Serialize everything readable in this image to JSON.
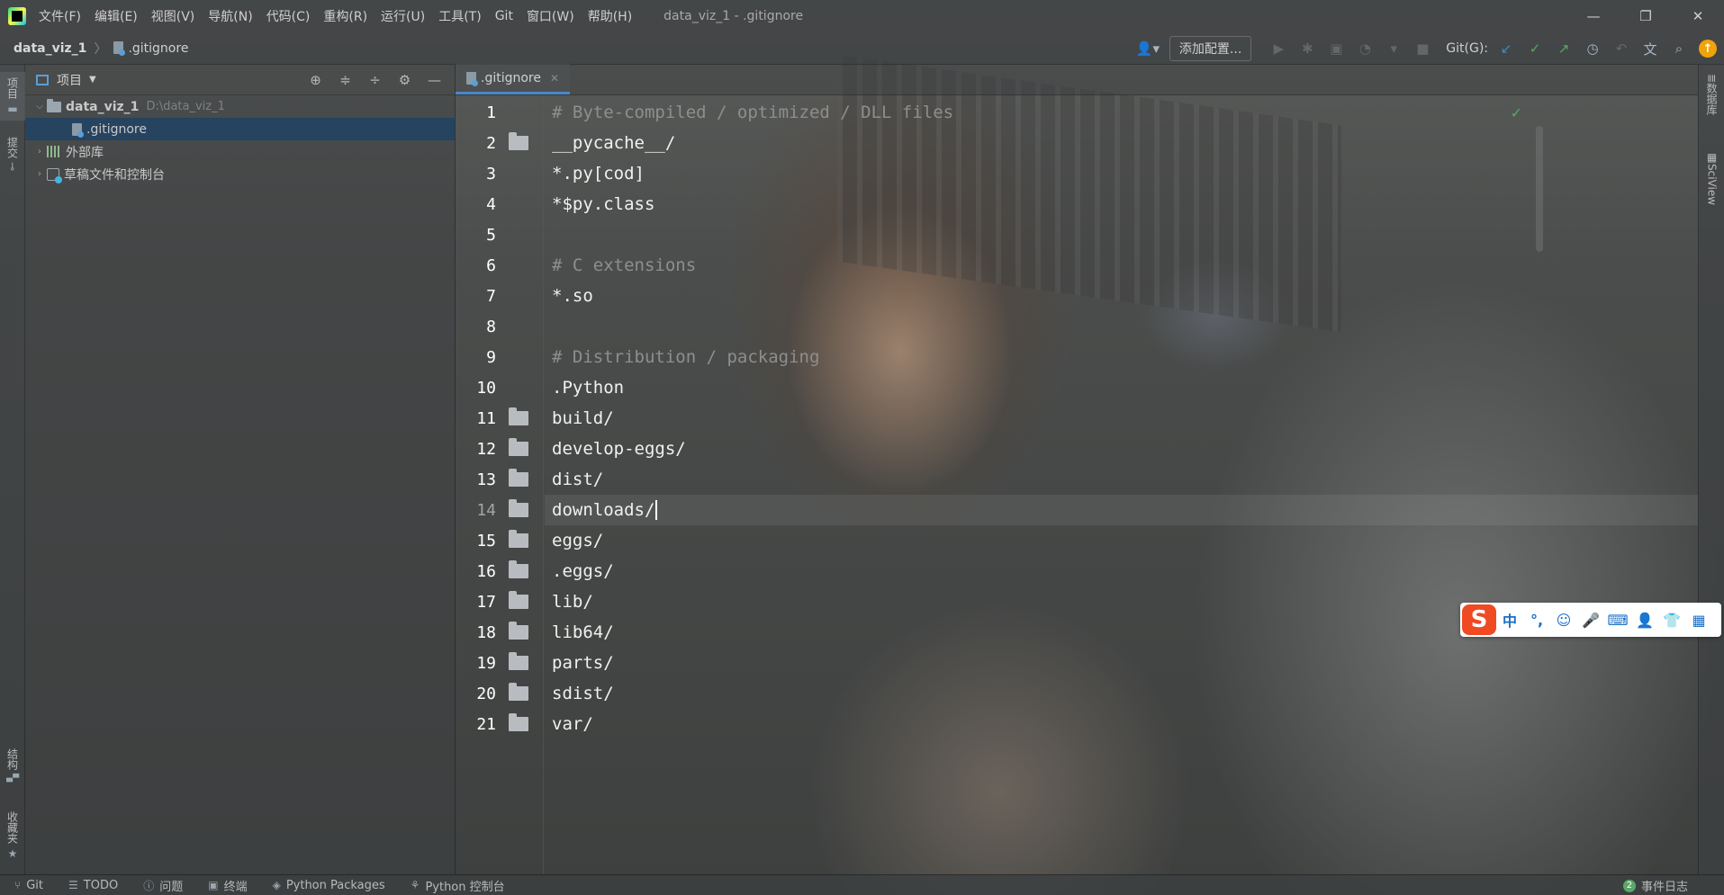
{
  "titlebar": {
    "menus": [
      "文件(F)",
      "编辑(E)",
      "视图(V)",
      "导航(N)",
      "代码(C)",
      "重构(R)",
      "运行(U)",
      "工具(T)",
      "Git",
      "窗口(W)",
      "帮助(H)"
    ],
    "window_title": "data_viz_1 - .gitignore",
    "minimize": "—",
    "restore": "❐",
    "close": "✕"
  },
  "navbar": {
    "project": "data_viz_1",
    "separator": "〉",
    "file": ".gitignore",
    "add_config": "添加配置...",
    "git_label": "Git(G):"
  },
  "left_stripe": {
    "project_tab": "项目",
    "commit_tab": "提交",
    "structure_tab": "结构",
    "favorites_tab": "收藏夹"
  },
  "project_panel": {
    "title": "项目",
    "tree": {
      "root": {
        "name": "data_viz_1",
        "path": "D:\\data_viz_1"
      },
      "file": ".gitignore",
      "external_libs": "外部库",
      "scratches": "草稿文件和控制台"
    }
  },
  "editor": {
    "tab_label": ".gitignore",
    "current_line": 14,
    "lines": [
      {
        "num": "1",
        "text": "# Byte-compiled / optimized / DLL files",
        "comment": true,
        "folder": false
      },
      {
        "num": "2",
        "text": "__pycache__/",
        "comment": false,
        "folder": true
      },
      {
        "num": "3",
        "text": "*.py[cod]",
        "comment": false,
        "folder": false
      },
      {
        "num": "4",
        "text": "*$py.class",
        "comment": false,
        "folder": false
      },
      {
        "num": "5",
        "text": "",
        "comment": false,
        "folder": false
      },
      {
        "num": "6",
        "text": "# C extensions",
        "comment": true,
        "folder": false
      },
      {
        "num": "7",
        "text": "*.so",
        "comment": false,
        "folder": false
      },
      {
        "num": "8",
        "text": "",
        "comment": false,
        "folder": false
      },
      {
        "num": "9",
        "text": "# Distribution / packaging",
        "comment": true,
        "folder": false
      },
      {
        "num": "10",
        "text": ".Python",
        "comment": false,
        "folder": false
      },
      {
        "num": "11",
        "text": "build/",
        "comment": false,
        "folder": true
      },
      {
        "num": "12",
        "text": "develop-eggs/",
        "comment": false,
        "folder": true
      },
      {
        "num": "13",
        "text": "dist/",
        "comment": false,
        "folder": true
      },
      {
        "num": "14",
        "text": "downloads/",
        "comment": false,
        "folder": true
      },
      {
        "num": "15",
        "text": "eggs/",
        "comment": false,
        "folder": true
      },
      {
        "num": "16",
        "text": ".eggs/",
        "comment": false,
        "folder": true
      },
      {
        "num": "17",
        "text": "lib/",
        "comment": false,
        "folder": true
      },
      {
        "num": "18",
        "text": "lib64/",
        "comment": false,
        "folder": true
      },
      {
        "num": "19",
        "text": "parts/",
        "comment": false,
        "folder": true
      },
      {
        "num": "20",
        "text": "sdist/",
        "comment": false,
        "folder": true
      },
      {
        "num": "21",
        "text": "var/",
        "comment": false,
        "folder": true
      }
    ]
  },
  "right_stripe": {
    "database_tab": "数据库",
    "sciview_tab": "SciView"
  },
  "ime": {
    "logo": "S",
    "items": [
      "中",
      "°,",
      "☺",
      "🎤",
      "⌨",
      "👤",
      "👕",
      "▦"
    ]
  },
  "statusbar": {
    "items": [
      "Git",
      "TODO",
      "问题",
      "终端",
      "Python Packages",
      "Python 控制台"
    ],
    "event_log": "事件日志",
    "event_count": "2"
  },
  "colors": {
    "selection": "#214264",
    "tab_underline": "#4a88c7",
    "comment": "#8e8e8e",
    "git_green": "#59a869",
    "git_blue": "#3592c4",
    "ime_logo": "#f04a23"
  }
}
